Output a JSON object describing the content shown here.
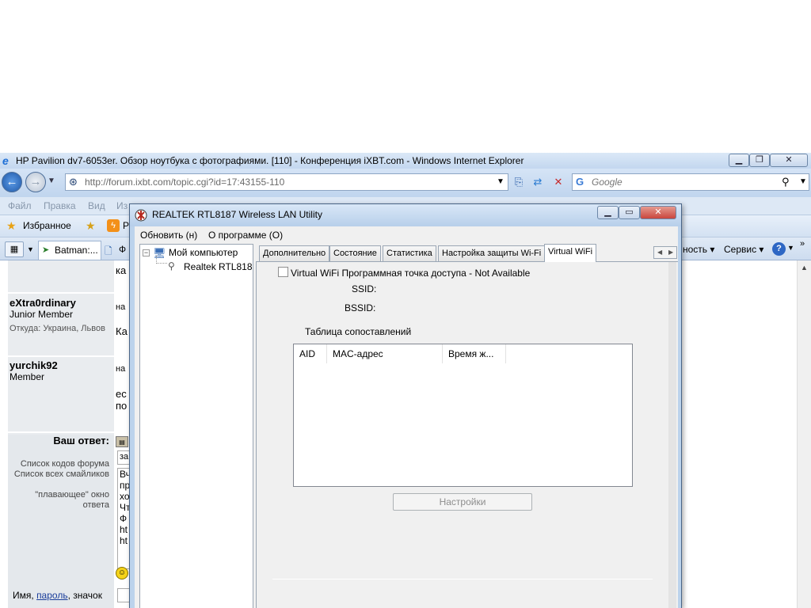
{
  "ie": {
    "title": "HP Pavilion dv7-6053er. Обзор ноутбука с фотографиями. [110] - Конференция iXBT.com - Windows Internet Explorer",
    "address_host": "http://forum.ixbt.com",
    "address_path": "/topic.cgi?id=17:43155-110",
    "search_placeholder": "Google",
    "menu": [
      "Файл",
      "Правка",
      "Вид",
      "Из"
    ],
    "favorites_label": "Избранное",
    "favorites_extra": "Р",
    "tab_label": "Batman:...",
    "tab_extra": "Ф",
    "tools_partial": "ность",
    "service_label": "Сервис",
    "help_icon": "?"
  },
  "forum": {
    "users": [
      {
        "name": "eXtra0rdinary",
        "role": "Junior Member",
        "from": "Откуда: Украина, Львов"
      },
      {
        "name": "yurchik92",
        "role": "Member"
      }
    ],
    "reply_label": "Ваш ответ:",
    "forum_codes": "Список кодов форума",
    "smiles_list": "Список всех смайликов",
    "floating_window": "\"плавающее\" окно",
    "reply_word": "ответа",
    "name_prefix": "Имя,",
    "password_link": "пароль",
    "name_suffix": ", значок",
    "snippets": [
      "ка",
      "на",
      "Ка",
      "на",
      "ес",
      "по",
      "за",
      "Вч",
      "пр",
      "хо",
      "Чт",
      "Ф",
      "ht",
      "ht"
    ]
  },
  "dialog": {
    "title": "REALTEK RTL8187 Wireless LAN Utility",
    "menu": {
      "refresh": "Обновить (н)",
      "about": "О программе (О)"
    },
    "tree": {
      "root": "Мой компьютер",
      "child": "Realtek RTL818"
    },
    "tabs": [
      "Дополнительно",
      "Состояние",
      "Статистика",
      "Настройка защиты Wi-Fi",
      "Virtual WiFi"
    ],
    "active_tab": "Virtual WiFi",
    "vwifi": {
      "checkbox_label": "Virtual WiFi Программная точка доступа - Not Available",
      "checked": false,
      "ssid_label": "SSID:",
      "bssid_label": "BSSID:",
      "table_title": "Таблица сопоставлений",
      "columns": [
        "AID",
        "MAC-адрес",
        "Время ж..."
      ],
      "rows": [],
      "settings_button": "Настройки",
      "settings_enabled": false
    }
  },
  "colors": {
    "chrome": "#c9dcf2",
    "dialog_frame": "#bcd3ec",
    "close_red": "#c9463d",
    "link": "#1a3d9a"
  }
}
